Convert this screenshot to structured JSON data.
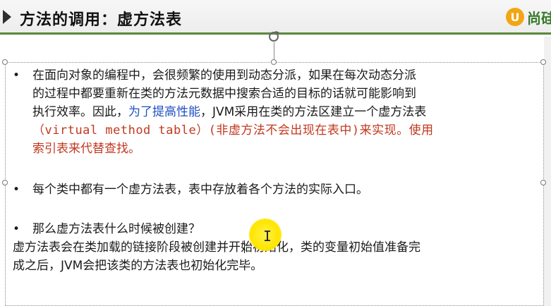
{
  "title": "方法的调用：虚方法表",
  "logo": {
    "mark": "U",
    "text": "尚硅"
  },
  "colors": {
    "accent_green": "#5b8a3c",
    "emphasis_red": "#c2381f",
    "emphasis_blue": "#1f4fc2",
    "logo_orange": "#f2a614"
  },
  "icons": {
    "header_arrow": "triangle-arrow-icon",
    "rotate": "rotate-icon",
    "logo": "logo-icon",
    "cursor": "i-beam-cursor-icon"
  },
  "bullet_char": "•",
  "bullets": [
    {
      "lines": [
        "在面向对象的编程中，会很频繁的使用到动态分派，如果在每次动态分派",
        "的过程中都要重新在类的方法元数据中搜索合适的目标的话就可能影响到"
      ],
      "line3_pre": "执行效率。因此，",
      "line3_blue": "为了提高性能",
      "line3_post": "，JVM采用在类的方法区建立一个虚方法表",
      "line4_red": "（virtual method table）(非虚方法不会出现在表中)来实现。使用",
      "line5_red": "索引表来代替查找。"
    },
    {
      "text": "每个类中都有一个虚方法表，表中存放着各个方法的实际入口。"
    },
    {
      "text": "那么虚方法表什么时候被创建？"
    }
  ],
  "answer_lines": [
    "虚方法表会在类加载的链接阶段被创建并开始初始化，类的变量初始值准备完",
    "成之后，JVM会把该类的方法表也初始化完毕。"
  ]
}
